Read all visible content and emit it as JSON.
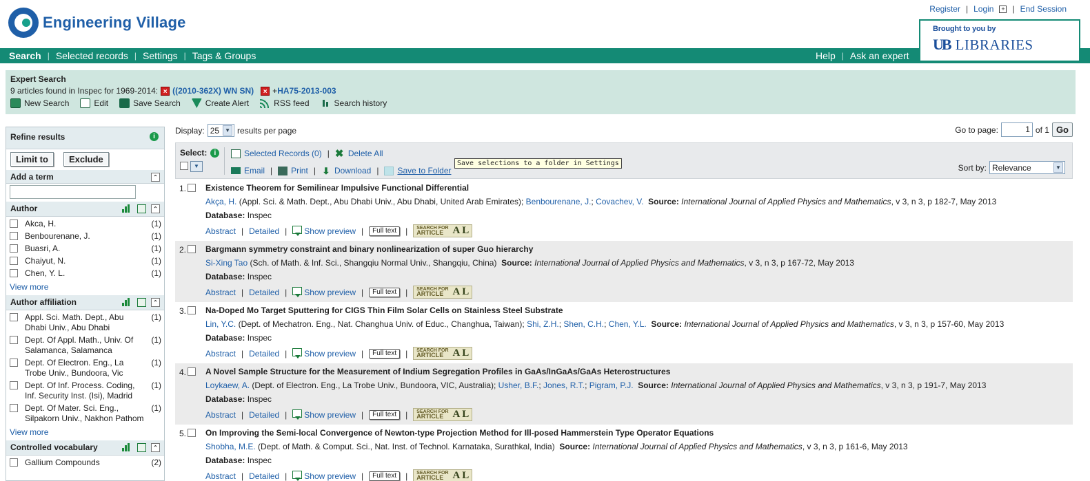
{
  "header": {
    "logo_text": "Engineering Village",
    "top_links": {
      "register": "Register",
      "login": "Login",
      "end_session": "End Session"
    },
    "brought_label": "Brought to you by",
    "libraries_mark": "UB",
    "libraries_text": "LIBRARIES"
  },
  "nav": {
    "left": [
      "Search",
      "Selected records",
      "Settings",
      "Tags & Groups"
    ],
    "right": [
      "Help",
      "Ask an expert"
    ]
  },
  "summary": {
    "title": "Expert Search",
    "found_text": "9 articles found in Inspec for 1969-2014:",
    "query1": "((2010-362X) WN SN)",
    "query2_prefix": "+",
    "query2": "HA75-2013-003",
    "tools": [
      "New Search",
      "Edit",
      "Save Search",
      "Create Alert",
      "RSS feed",
      "Search history"
    ]
  },
  "sidebar": {
    "refine_title": "Refine results",
    "limit_label": "Limit to",
    "exclude_label": "Exclude",
    "add_term_title": "Add a term",
    "author": {
      "title": "Author",
      "items": [
        {
          "label": "Akca, H.",
          "count": "(1)"
        },
        {
          "label": "Benbourenane, J.",
          "count": "(1)"
        },
        {
          "label": "Buasri, A.",
          "count": "(1)"
        },
        {
          "label": "Chaiyut, N.",
          "count": "(1)"
        },
        {
          "label": "Chen, Y. L.",
          "count": "(1)"
        }
      ],
      "view_more": "View more"
    },
    "affiliation": {
      "title": "Author affiliation",
      "items": [
        {
          "label": "Appl. Sci. Math. Dept., Abu Dhabi Univ., Abu Dhabi",
          "count": "(1)"
        },
        {
          "label": "Dept. Of Appl. Math., Univ. Of Salamanca, Salamanca",
          "count": "(1)"
        },
        {
          "label": "Dept. Of Electron. Eng., La Trobe Univ., Bundoora, Vic",
          "count": "(1)"
        },
        {
          "label": "Dept. Of Inf. Process. Coding, Inf. Security Inst. (Isi), Madrid",
          "count": "(1)"
        },
        {
          "label": "Dept. Of Mater. Sci. Eng., Silpakorn Univ., Nakhon Pathom",
          "count": "(1)"
        }
      ],
      "view_more": "View more"
    },
    "vocab": {
      "title": "Controlled vocabulary",
      "items": [
        {
          "label": "Gallium Compounds",
          "count": "(2)"
        }
      ]
    }
  },
  "main": {
    "display_label": "Display:",
    "display_value": "25",
    "per_page": "results per page",
    "goto_label": "Go to page:",
    "goto_value": "1",
    "of_label": "of 1",
    "go_button": "Go",
    "select_label": "Select:",
    "selected_records": "Selected Records (0)",
    "delete_all": "Delete All",
    "email": "Email",
    "print": "Print",
    "download": "Download",
    "save_to_folder": "Save to Folder",
    "tooltip": "Save selections to a folder in Settings",
    "sort_label": "Sort by:",
    "sort_value": "Relevance"
  },
  "result_labels": {
    "source": "Source:",
    "database": "Database:",
    "abstract": "Abstract",
    "detailed": "Detailed",
    "show_preview": "Show preview",
    "full_text": "Full text",
    "sfa_line1": "SEARCH FOR",
    "sfa_line2": "ARTICLE",
    "sfa_al": "A L"
  },
  "results": [
    {
      "num": "1.",
      "title": "Existence Theorem for Semilinear Impulsive Functional Differential",
      "authors": [
        {
          "name": "Akça, H.",
          "affil": " (Appl. Sci. & Math. Dept., Abu Dhabi Univ., Abu Dhabi, United Arab Emirates); "
        },
        {
          "name": "Benbourenane, J.",
          "affil": "; "
        },
        {
          "name": "Covachev, V.",
          "affil": ""
        }
      ],
      "journal": "International Journal of Applied Physics and Mathematics",
      "details": ", v 3, n 3, p 182-7, May 2013",
      "database": "Inspec"
    },
    {
      "num": "2.",
      "title": "Bargmann symmetry constraint and binary nonlinearization of super Guo hierarchy",
      "authors": [
        {
          "name": "Si-Xing Tao",
          "affil": " (Sch. of Math. & Inf. Sci., Shangqiu Normal Univ., Shangqiu, China)"
        }
      ],
      "journal": "International Journal of Applied Physics and Mathematics",
      "details": ", v 3, n 3, p 167-72, May 2013",
      "database": "Inspec"
    },
    {
      "num": "3.",
      "title": "Na-Doped Mo Target Sputtering for CIGS Thin Film Solar Cells on Stainless Steel Substrate",
      "authors": [
        {
          "name": "Lin, Y.C.",
          "affil": " (Dept. of Mechatron. Eng., Nat. Changhua Univ. of Educ., Changhua, Taiwan); "
        },
        {
          "name": "Shi, Z.H.",
          "affil": "; "
        },
        {
          "name": "Shen, C.H.",
          "affil": "; "
        },
        {
          "name": "Chen, Y.L.",
          "affil": ""
        }
      ],
      "journal": "International Journal of Applied Physics and Mathematics",
      "details": ", v 3, n 3, p 157-60, May 2013",
      "database": "Inspec"
    },
    {
      "num": "4.",
      "title": "A Novel Sample Structure for the Measurement of Indium Segregation Profiles in GaAs/InGaAs/GaAs Heterostructures",
      "authors": [
        {
          "name": "Loykaew, A.",
          "affil": " (Dept. of Electron. Eng., La Trobe Univ., Bundoora, VIC, Australia); "
        },
        {
          "name": "Usher, B.F.",
          "affil": "; "
        },
        {
          "name": "Jones, R.T.",
          "affil": "; "
        },
        {
          "name": "Pigram, P.J.",
          "affil": ""
        }
      ],
      "journal": "International Journal of Applied Physics and Mathematics",
      "details": ", v 3, n 3, p 191-7, May 2013",
      "database": "Inspec"
    },
    {
      "num": "5.",
      "title": "On Improving the Semi-local Convergence of Newton-type Projection Method for Ill-posed Hammerstein Type Operator Equations",
      "authors": [
        {
          "name": "Shobha, M.E.",
          "affil": " (Dept. of Math. & Comput. Sci., Nat. Inst. of Technol. Karnataka, Surathkal, India)"
        }
      ],
      "journal": "International Journal of Applied Physics and Mathematics",
      "details": ", v 3, n 3, p 161-6, May 2013",
      "database": "Inspec"
    }
  ]
}
